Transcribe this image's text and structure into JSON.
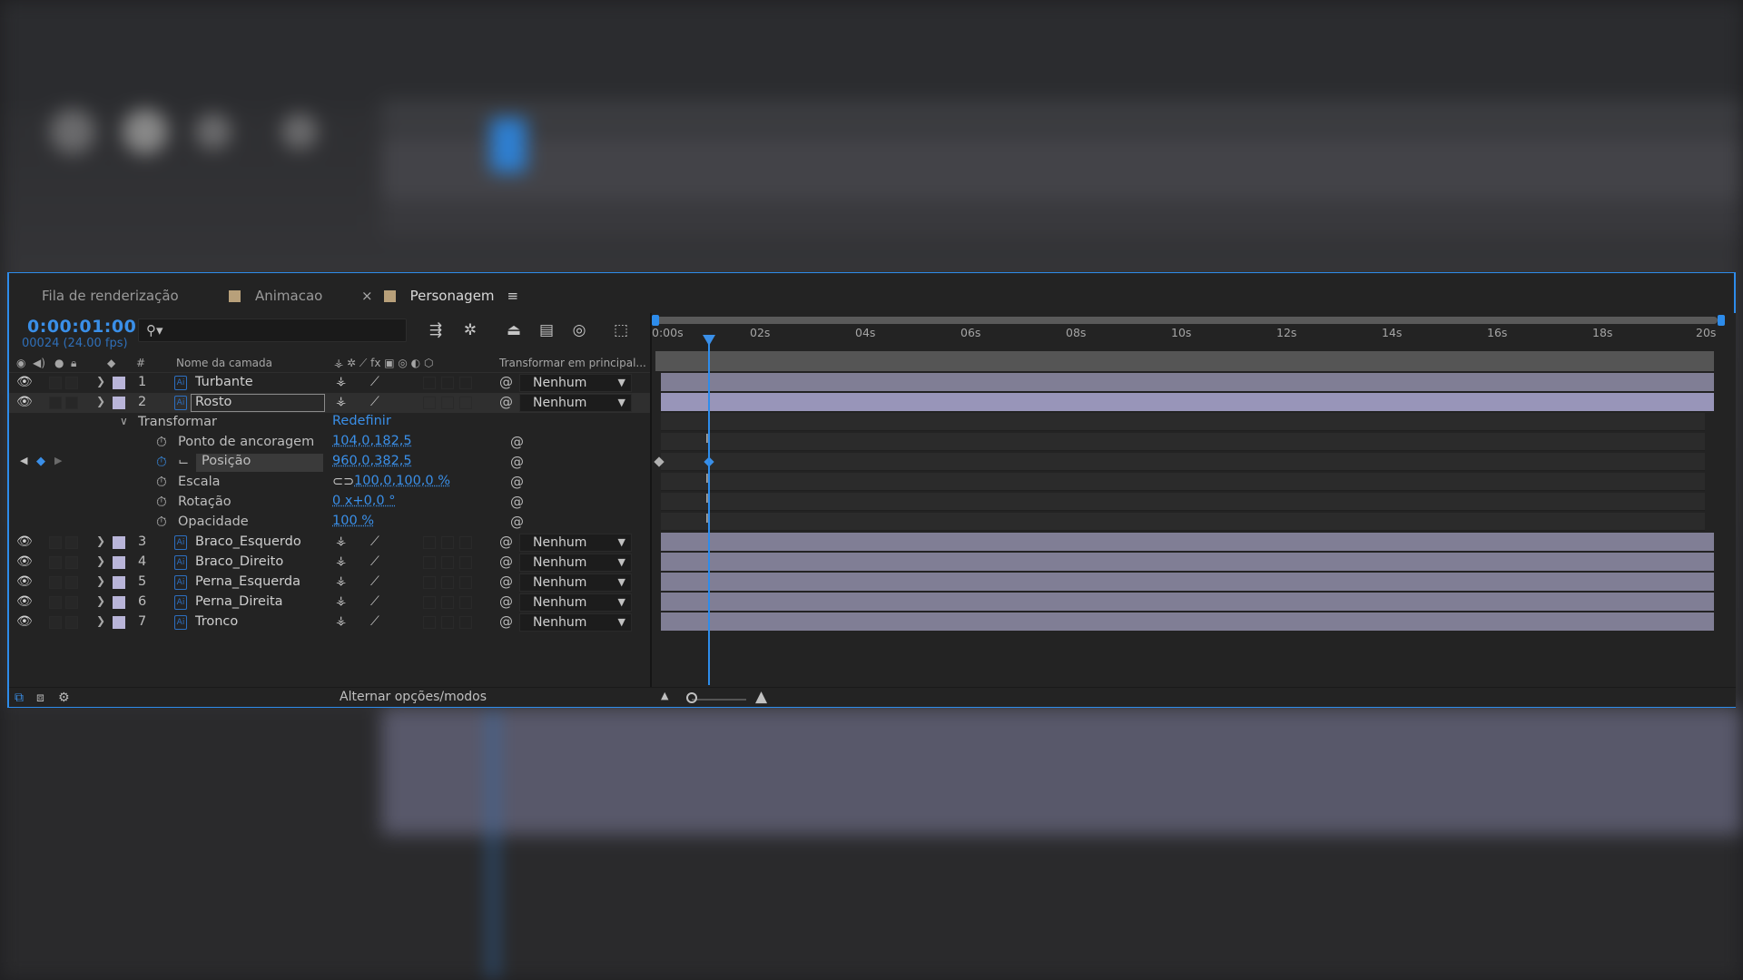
{
  "tabs": [
    {
      "label": "Fila de renderização",
      "active": false
    },
    {
      "label": "Animacao",
      "active": false
    },
    {
      "label": "Personagem",
      "active": true
    }
  ],
  "tab_close": "×",
  "tab_menu": "≡",
  "timecode": "0:00:01:00",
  "timecode_sub": "00024 (24.00 fps)",
  "column_headers": {
    "number": "#",
    "layer_name": "Nome da camada",
    "parent": "Transformar em principal..."
  },
  "layers": [
    {
      "num": "1",
      "name": "Turbante",
      "parent": "Nenhum",
      "expanded": false
    },
    {
      "num": "2",
      "name": "Rosto",
      "parent": "Nenhum",
      "expanded": true,
      "selected": true
    },
    {
      "num": "3",
      "name": "Braco_Esquerdo",
      "parent": "Nenhum",
      "expanded": false
    },
    {
      "num": "4",
      "name": "Braco_Direito",
      "parent": "Nenhum",
      "expanded": false
    },
    {
      "num": "5",
      "name": "Perna_Esquerda",
      "parent": "Nenhum",
      "expanded": false
    },
    {
      "num": "6",
      "name": "Perna_Direita",
      "parent": "Nenhum",
      "expanded": false
    },
    {
      "num": "7",
      "name": "Tronco",
      "parent": "Nenhum",
      "expanded": false
    }
  ],
  "transform": {
    "label": "Transformar",
    "reset": "Redefinir",
    "props": [
      {
        "label": "Ponto de ancoragem",
        "value": "104,0,182,5"
      },
      {
        "label": "Posição",
        "value": "960,0,382,5"
      },
      {
        "label": "Escala",
        "value": "100,0,100,0 %"
      },
      {
        "label": "Rotação",
        "value": "0 x+0,0 °"
      },
      {
        "label": "Opacidade",
        "value": "100 %"
      }
    ]
  },
  "footer": {
    "toggle_label": "Alternar opções/modos"
  },
  "ruler_ticks": [
    "0:00s",
    "02s",
    "04s",
    "06s",
    "08s",
    "10s",
    "12s",
    "14s",
    "16s",
    "18s",
    "20s"
  ],
  "colors": {
    "accent": "#2d8ceb",
    "layer_label": "#b9b5d9",
    "lane": "#807e95",
    "lane_selected": "#9895b9",
    "tab_swatch": "#b8a07a"
  }
}
